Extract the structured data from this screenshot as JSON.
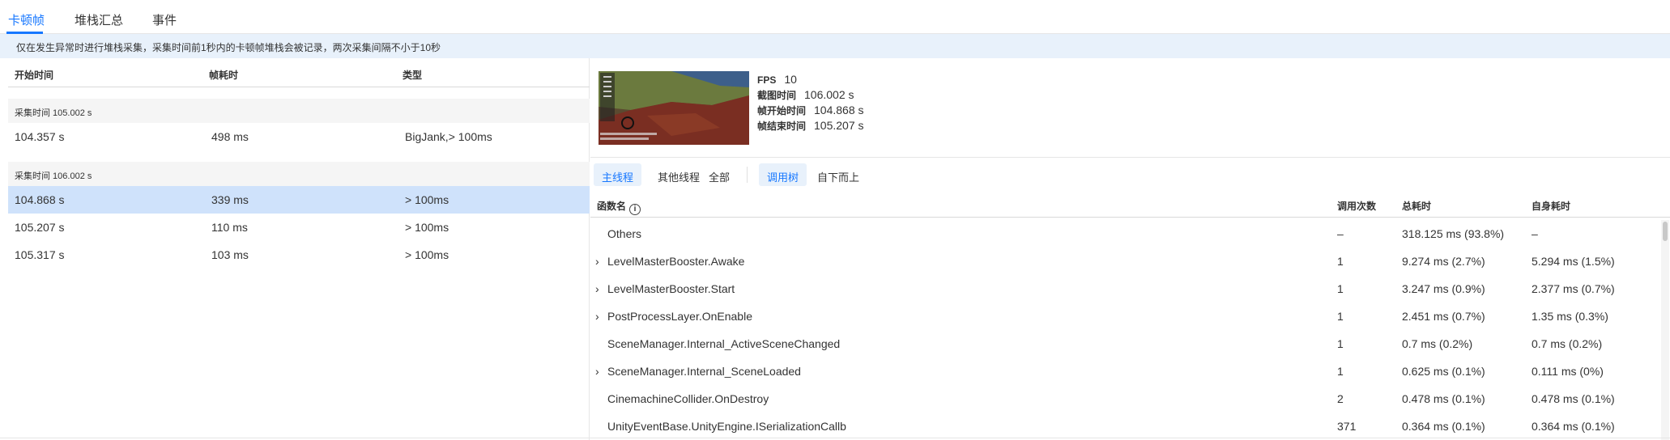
{
  "tabs": [
    "卡顿帧",
    "堆栈汇总",
    "事件"
  ],
  "notice": "仅在发生异常时进行堆栈采集，采集时间前1秒内的卡顿帧堆栈会被记录，两次采集间隔不小于10秒",
  "left_table": {
    "columns": [
      "开始时间",
      "帧耗时",
      "类型"
    ],
    "groups": [
      {
        "label": "采集时间 105.002 s",
        "rows": [
          {
            "start": "104.357 s",
            "cost": "498 ms",
            "type": "BigJank,> 100ms"
          }
        ]
      },
      {
        "label": "采集时间 106.002 s",
        "rows": [
          {
            "start": "104.868 s",
            "cost": "339 ms",
            "type": "> 100ms",
            "selected": true
          },
          {
            "start": "105.207 s",
            "cost": "110 ms",
            "type": "> 100ms"
          },
          {
            "start": "105.317 s",
            "cost": "103 ms",
            "type": "> 100ms"
          }
        ]
      }
    ]
  },
  "frame_info": [
    {
      "label": "FPS",
      "value": "10"
    },
    {
      "label": "截图时间",
      "value": "106.002 s"
    },
    {
      "label": "帧开始时间",
      "value": "104.868 s"
    },
    {
      "label": "帧结束时间",
      "value": "105.207 s"
    }
  ],
  "thread_tabs": [
    "主线程",
    "其他线程",
    "全部"
  ],
  "view_tabs": [
    "调用树",
    "自下而上"
  ],
  "call_table": {
    "columns": [
      "函数名",
      "调用次数",
      "总耗时",
      "自身耗时"
    ],
    "info_icon": "info-icon",
    "rows": [
      {
        "name": "Others",
        "calls": "–",
        "total": "318.125 ms (93.8%)",
        "self": "–",
        "expandable": false
      },
      {
        "name": "LevelMasterBooster.Awake",
        "calls": "1",
        "total": "9.274 ms (2.7%)",
        "self": "5.294 ms (1.5%)",
        "expandable": true
      },
      {
        "name": "LevelMasterBooster.Start",
        "calls": "1",
        "total": "3.247 ms (0.9%)",
        "self": "2.377 ms (0.7%)",
        "expandable": true
      },
      {
        "name": "PostProcessLayer.OnEnable",
        "calls": "1",
        "total": "2.451 ms (0.7%)",
        "self": "1.35 ms (0.3%)",
        "expandable": true
      },
      {
        "name": "SceneManager.Internal_ActiveSceneChanged",
        "calls": "1",
        "total": "0.7 ms (0.2%)",
        "self": "0.7 ms (0.2%)",
        "expandable": false
      },
      {
        "name": "SceneManager.Internal_SceneLoaded",
        "calls": "1",
        "total": "0.625 ms (0.1%)",
        "self": "0.111 ms (0%)",
        "expandable": true
      },
      {
        "name": "CinemachineCollider.OnDestroy",
        "calls": "2",
        "total": "0.478 ms (0.1%)",
        "self": "0.478 ms (0.1%)",
        "expandable": false
      },
      {
        "name": "UnityEventBase.UnityEngine.ISerializationCallb",
        "calls": "371",
        "total": "0.364 ms (0.1%)",
        "self": "0.364 ms (0.1%)",
        "expandable": false
      }
    ]
  },
  "colors": {
    "accent": "#1677ff",
    "selected_row": "#cfe2fb",
    "notice_bg": "#e8f1fb"
  }
}
